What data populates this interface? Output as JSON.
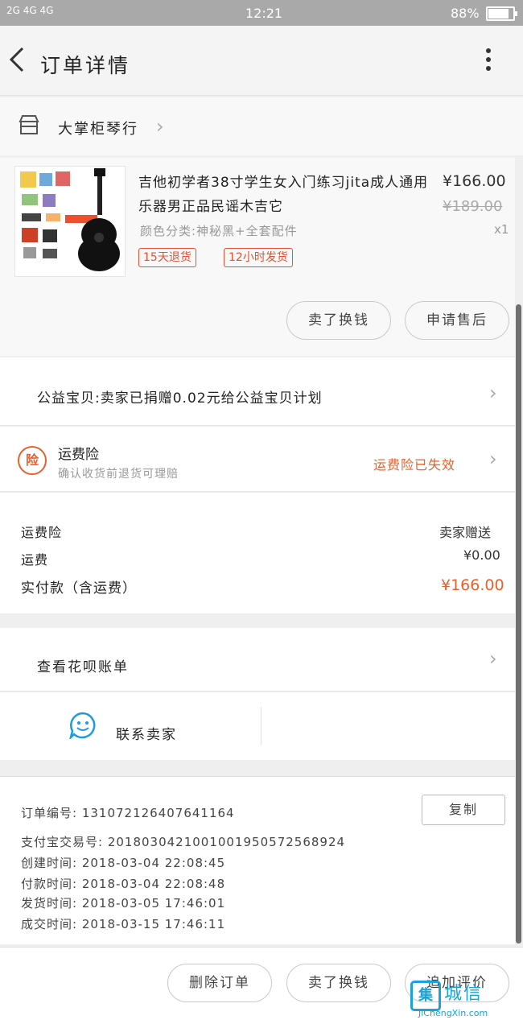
{
  "statusbar": {
    "signal": "2G  4G 4G",
    "time": "12:21",
    "battery": "88%",
    "battery_level": 0.88
  },
  "header": {
    "title": "订单详情"
  },
  "shop": {
    "name": "大掌柜琴行"
  },
  "product": {
    "name": "吉他初学者38寸学生女入门练习jita成人通用乐器男正品民谣木吉它",
    "price": "¥166.00",
    "original_price": "¥189.00",
    "sku": "颜色分类:神秘黑+全套配件",
    "quantity": "x1",
    "tags": [
      "15天退货",
      "12小时发货"
    ],
    "buttons": [
      "卖了换钱",
      "申请售后"
    ]
  },
  "charity": {
    "text": "公益宝贝:卖家已捐赠0.02元给公益宝贝计划"
  },
  "insurance": {
    "icon_text": "险",
    "title": "运费险",
    "subtitle": "确认收货前退货可理赔",
    "status": "运费险已失效"
  },
  "fees": [
    {
      "label": "运费险",
      "value": "卖家赠送"
    },
    {
      "label": "运费",
      "value": "¥0.00"
    }
  ],
  "total": {
    "label": "实付款（含运费）",
    "value": "¥166.00"
  },
  "huabei": {
    "text": "查看花呗账单"
  },
  "contact": {
    "label": "联系卖家"
  },
  "order_info": {
    "copy_label": "复制",
    "rows": [
      "订单编号: 131072126407641164",
      "支付宝交易号: 2018030421001001950572568924",
      "创建时间: 2018-03-04 22:08:45",
      "付款时间: 2018-03-04 22:08:48",
      "发货时间: 2018-03-05 17:46:01",
      "成交时间: 2018-03-15 17:46:11"
    ]
  },
  "bottom": {
    "buttons": [
      "删除订单",
      "卖了换钱",
      "追加评价"
    ]
  },
  "watermark": {
    "mark": "集",
    "text": "城信",
    "url": "JiChengXin.com"
  },
  "colors": {
    "accent": "#e8602e",
    "statusbar": "#a9a9a9",
    "contact_blue": "#1e9be0"
  }
}
